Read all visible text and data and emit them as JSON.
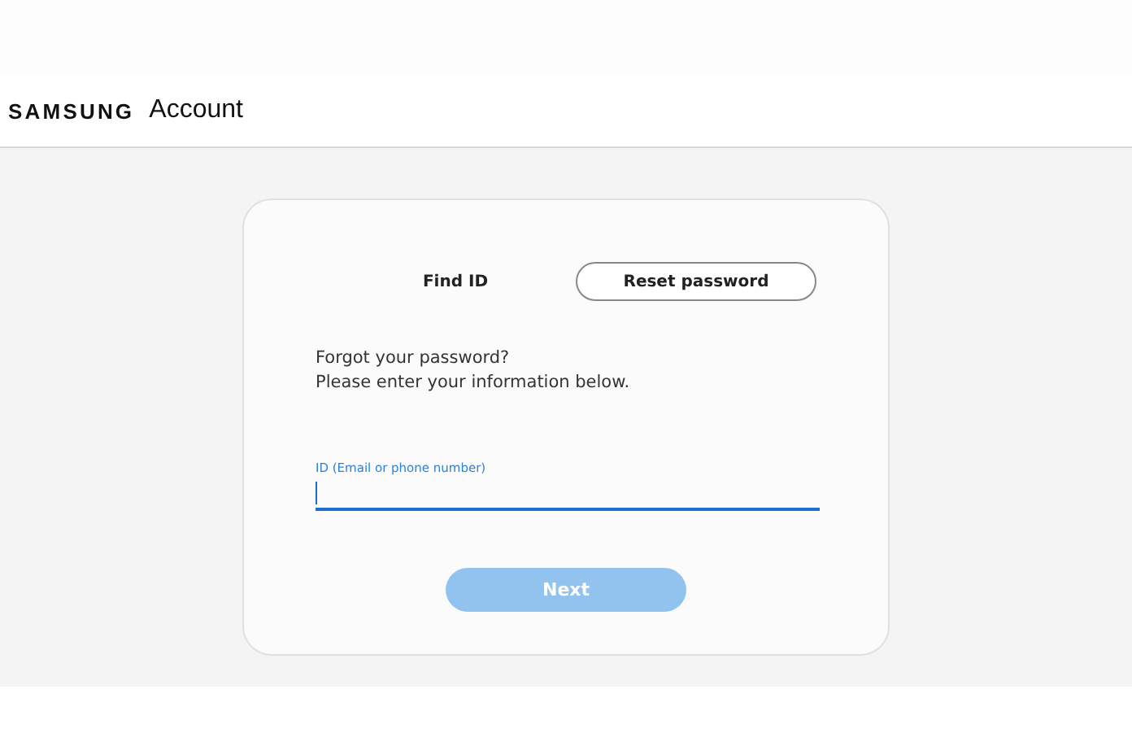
{
  "header": {
    "brand": "SAMSUNG",
    "product": "Account"
  },
  "tabs": [
    {
      "label": "Find ID",
      "selected": false
    },
    {
      "label": "Reset password",
      "selected": true
    }
  ],
  "message": [
    "Forgot your password?",
    "Please enter your information below."
  ],
  "field": {
    "label": "ID (Email or phone number)",
    "focused": true
  },
  "next_button": {
    "label": "Next",
    "disabled": true
  }
}
